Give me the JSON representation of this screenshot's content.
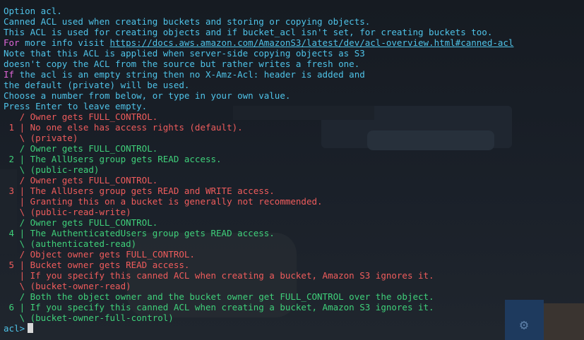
{
  "intro": [
    "Option acl.",
    "Canned ACL used when creating buckets and storing or copying objects.",
    "This ACL is used for creating objects and if bucket_acl isn't set, for creating buckets too."
  ],
  "info": {
    "prefix": "For",
    "text": " more info visit ",
    "link": "https://docs.aws.amazon.com/AmazonS3/latest/dev/acl-overview.html#canned-acl"
  },
  "note": [
    "Note that this ACL is applied when server-side copying objects as S3",
    "doesn't copy the ACL from the source but rather writes a fresh one."
  ],
  "empty_note": {
    "prefix": "If",
    "text": " the acl is an empty string then no X-Amz-Acl: header is added and"
  },
  "tail": [
    "the default (private) will be used.",
    "Choose a number from below, or type in your own value.",
    "Press Enter to leave empty."
  ],
  "options": [
    {
      "color": "red",
      "lines": [
        "   / Owner gets FULL_CONTROL.",
        " 1 | No one else has access rights (default).",
        "   \\ (private)"
      ]
    },
    {
      "color": "green",
      "lines": [
        "   / Owner gets FULL_CONTROL.",
        " 2 | The AllUsers group gets READ access.",
        "   \\ (public-read)"
      ]
    },
    {
      "color": "red",
      "lines": [
        "   / Owner gets FULL_CONTROL.",
        " 3 | The AllUsers group gets READ and WRITE access.",
        "   | Granting this on a bucket is generally not recommended.",
        "   \\ (public-read-write)"
      ]
    },
    {
      "color": "green",
      "lines": [
        "   / Owner gets FULL_CONTROL.",
        " 4 | The AuthenticatedUsers group gets READ access.",
        "   \\ (authenticated-read)"
      ]
    },
    {
      "color": "red",
      "lines": [
        "   / Object owner gets FULL_CONTROL.",
        " 5 | Bucket owner gets READ access.",
        "   | If you specify this canned ACL when creating a bucket, Amazon S3 ignores it.",
        "   \\ (bucket-owner-read)"
      ]
    },
    {
      "color": "green",
      "lines": [
        "   / Both the object owner and the bucket owner get FULL_CONTROL over the object.",
        " 6 | If you specify this canned ACL when creating a bucket, Amazon S3 ignores it.",
        "   \\ (bucket-owner-full-control)"
      ]
    }
  ],
  "prompt": "acl>",
  "prompt_input_value": "",
  "background": {
    "gear_icon": "gear-icon"
  },
  "colors": {
    "cyan": "#4fc3e8",
    "magenta": "#e066d8",
    "red": "#ef5c5c",
    "green": "#3fd07a",
    "background": "#171c23"
  }
}
